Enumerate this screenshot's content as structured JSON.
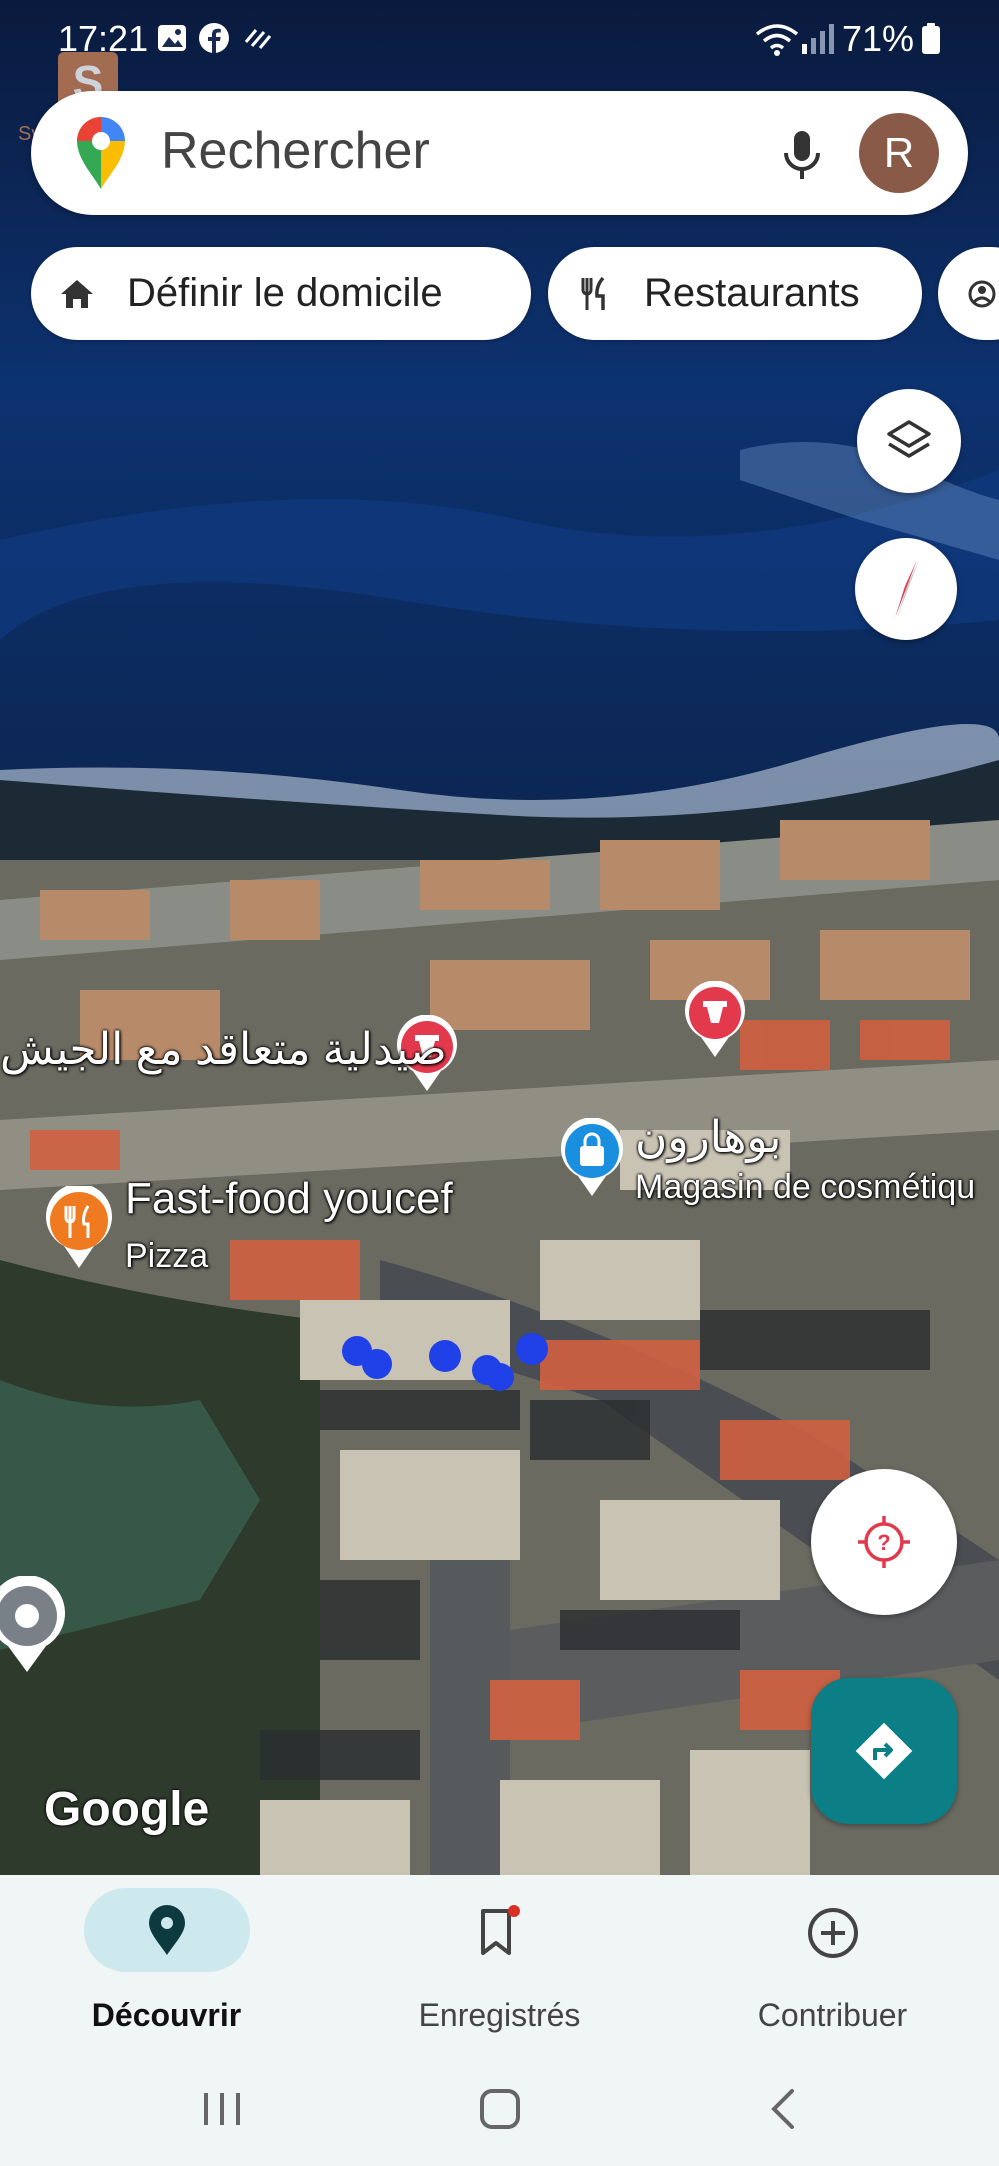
{
  "status_bar": {
    "time": "17:21",
    "battery": "71%"
  },
  "search": {
    "placeholder": "Rechercher",
    "avatar_initial": "R"
  },
  "chips": [
    {
      "label": "Définir le domicile",
      "icon": "home-icon"
    },
    {
      "label": "Restaurants",
      "icon": "restaurant-icon"
    },
    {
      "label": "",
      "icon": "more-icon"
    }
  ],
  "map": {
    "pharmacy_label": "صيدلية متعاقد مع الجيش",
    "shop_label": "بوهارون",
    "shop_category": "Magasin de cosmétiqu",
    "restaurant_label": "Fast-food youcef",
    "restaurant_category": "Pizza",
    "attribution": "Google"
  },
  "bottom_nav": [
    {
      "label": "Découvrir",
      "active": true,
      "icon": "explore-pin-icon"
    },
    {
      "label": "Enregistrés",
      "active": false,
      "icon": "bookmark-icon"
    },
    {
      "label": "Contribuer",
      "active": false,
      "icon": "add-circle-icon"
    }
  ],
  "colors": {
    "accent": "#0b7e86",
    "pharmacy": "#e3394d",
    "shop": "#1a8fe0",
    "food": "#f07a20"
  }
}
